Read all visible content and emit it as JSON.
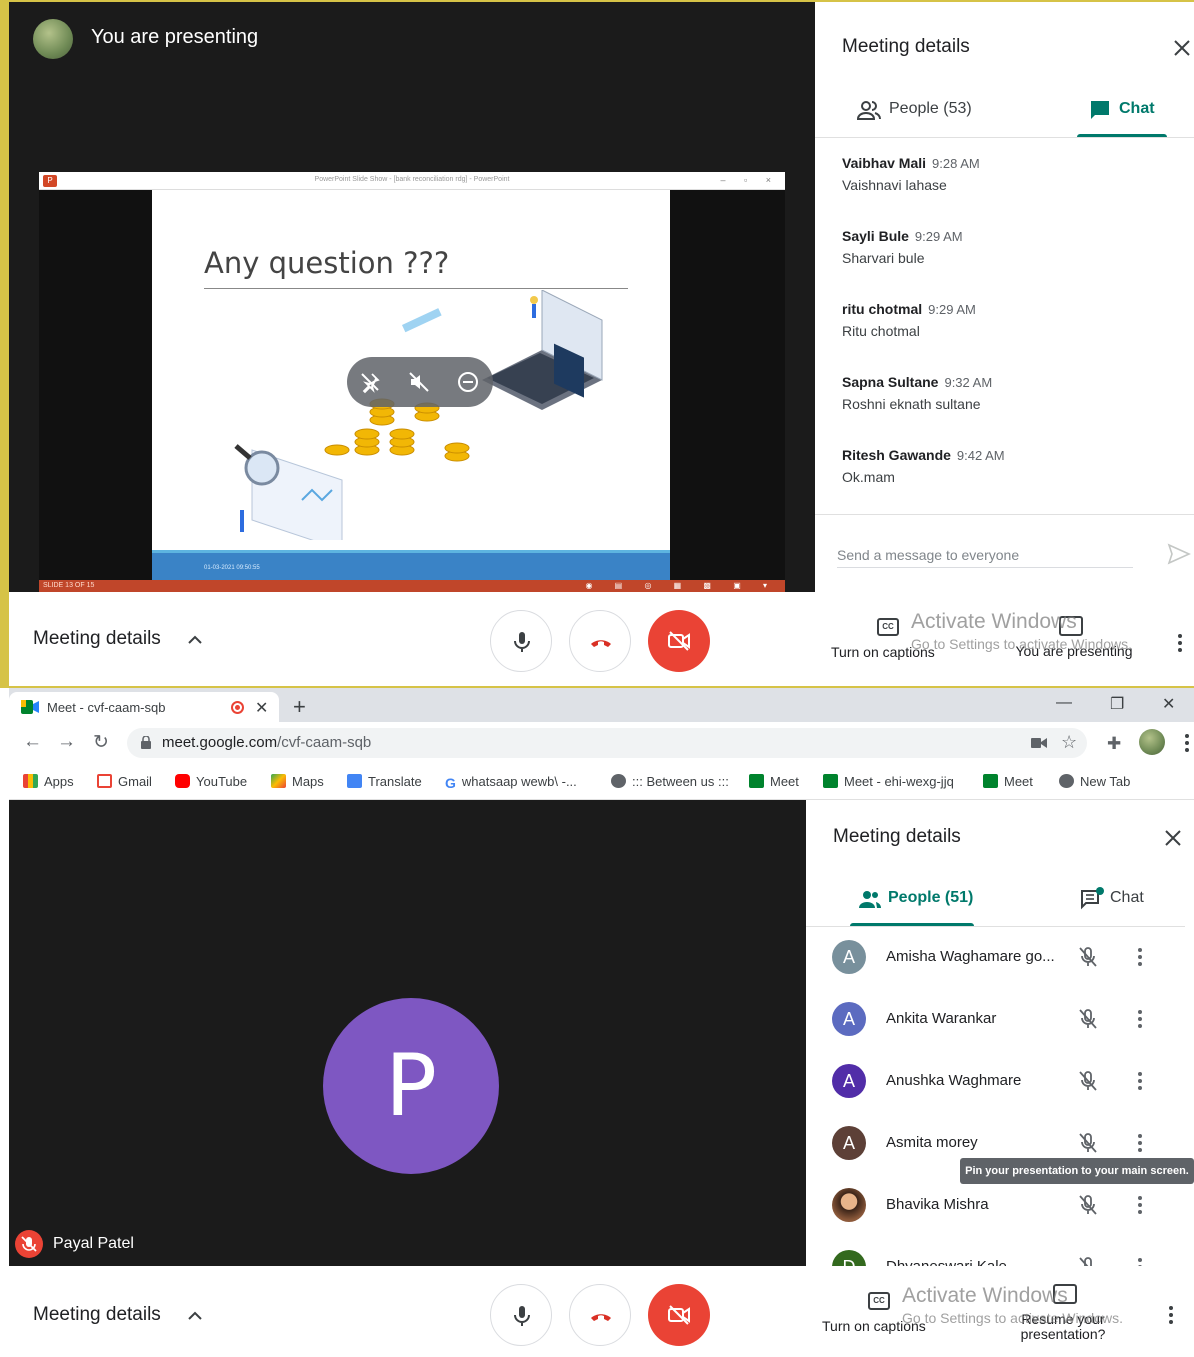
{
  "top": {
    "presenting_label": "You are presenting",
    "ppt": {
      "window_title": "PowerPoint Slide Show - [bank reconciliation rdg] - PowerPoint",
      "slide_title": "Any question ???",
      "slide_date": "01-03-2021 09:50:55",
      "slide_counter": "SLIDE 13 OF 15"
    },
    "panel": {
      "title": "Meeting details",
      "tab_people": "People (53)",
      "tab_chat": "Chat",
      "messages": [
        {
          "sender": "Vaibhav Mali",
          "time": "9:28 AM",
          "text": "Vaishnavi lahase"
        },
        {
          "sender": "Sayli Bule",
          "time": "9:29 AM",
          "text": "Sharvari bule"
        },
        {
          "sender": "ritu chotmal",
          "time": "9:29 AM",
          "text": "Ritu chotmal"
        },
        {
          "sender": "Sapna Sultane",
          "time": "9:32 AM",
          "text": "Roshni eknath sultane"
        },
        {
          "sender": "Ritesh Gawande",
          "time": "9:42 AM",
          "text": "Ok.mam"
        }
      ],
      "send_placeholder": "Send a message to everyone"
    },
    "controls": {
      "meeting_details": "Meeting details",
      "captions": "Turn on captions",
      "present": "You are presenting",
      "watermark_line1": "Activate Windows",
      "watermark_line2": "Go to Settings to activate Windows."
    }
  },
  "chrome": {
    "tab_title": "Meet - cvf-caam-sqb",
    "url_host": "meet.google.com",
    "url_path": "/cvf-caam-sqb",
    "bookmarks": [
      "Apps",
      "Gmail",
      "YouTube",
      "Maps",
      "Translate",
      "whatsaap wewb\\ -...",
      "::: Between us :::",
      "Meet",
      "Meet - ehi-wexg-jjq",
      "Meet",
      "New Tab"
    ]
  },
  "bottom": {
    "avatar_letter": "P",
    "participant_name": "Payal Patel",
    "panel": {
      "title": "Meeting details",
      "tab_people": "People (51)",
      "tab_chat": "Chat",
      "people": [
        {
          "initial": "A",
          "name": "Amisha Waghamare go...",
          "color": "#78909c"
        },
        {
          "initial": "A",
          "name": "Ankita Warankar",
          "color": "#5c6bc0"
        },
        {
          "initial": "A",
          "name": "Anushka Waghmare",
          "color": "#512da8"
        },
        {
          "initial": "A",
          "name": "Asmita morey",
          "color": "#5d4037"
        },
        {
          "initial": "",
          "name": "Bhavika Mishra",
          "color": "#8d5a3b"
        },
        {
          "initial": "D",
          "name": "Dhyaneswari Kale",
          "color": "#33691e"
        }
      ],
      "tooltip": "Pin your presentation to your main screen."
    },
    "controls": {
      "meeting_details": "Meeting details",
      "captions": "Turn on captions",
      "resume": "Resume your presentation?",
      "watermark_line1": "Activate Windows",
      "watermark_line2": "Go to Settings to activate Windows."
    }
  },
  "colors": {
    "accent_teal": "#00796b",
    "danger_red": "#ea4335",
    "avatar_purple": "#7e57c2",
    "ppt_orange": "#c0462a",
    "screen_border": "#d6c347"
  }
}
